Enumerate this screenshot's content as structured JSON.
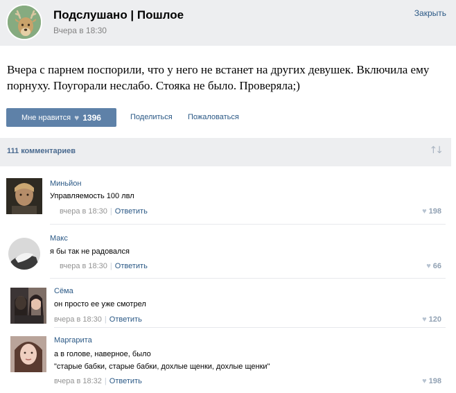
{
  "header": {
    "group_title": "Подслушано | Пошлое",
    "date": "Вчера в 18:30",
    "close_label": "Закрыть"
  },
  "post": {
    "text": "Вчера с парнем поспорили, что у него не встанет на других девушек. Включила ему порнуху. Поугорали неслабо. Стояка не было. Проверяла;)",
    "like_label": "Мне нравится",
    "like_count": "1396",
    "share_label": "Поделиться",
    "report_label": "Пожаловаться"
  },
  "comments_bar": {
    "count_label": "111 комментариев",
    "sort_icon": "sort-arrows-icon"
  },
  "comments": [
    {
      "author": "Миньйон",
      "lines": [
        "Управляемость 100 лвл"
      ],
      "time": "вчера в 18:30",
      "reply": "Ответить",
      "likes": "198"
    },
    {
      "author": "Макс",
      "lines": [
        "я бы так не радовался"
      ],
      "time": "вчера в 18:30",
      "reply": "Ответить",
      "likes": "66"
    },
    {
      "author": "Сёма",
      "lines": [
        "он просто ее уже смотрел"
      ],
      "time": "вчера в 18:30",
      "reply": "Ответить",
      "likes": "120"
    },
    {
      "author": "Маргарита",
      "lines": [
        "а в голове, наверное, было",
        "\"старые бабки, старые бабки, дохлые щенки, дохлые щенки\""
      ],
      "time": "вчера в 18:32",
      "reply": "Ответить",
      "likes": "198"
    }
  ],
  "colors": {
    "accent": "#5e81a8",
    "link": "#2a5885",
    "bar_bg": "#edeef0"
  }
}
